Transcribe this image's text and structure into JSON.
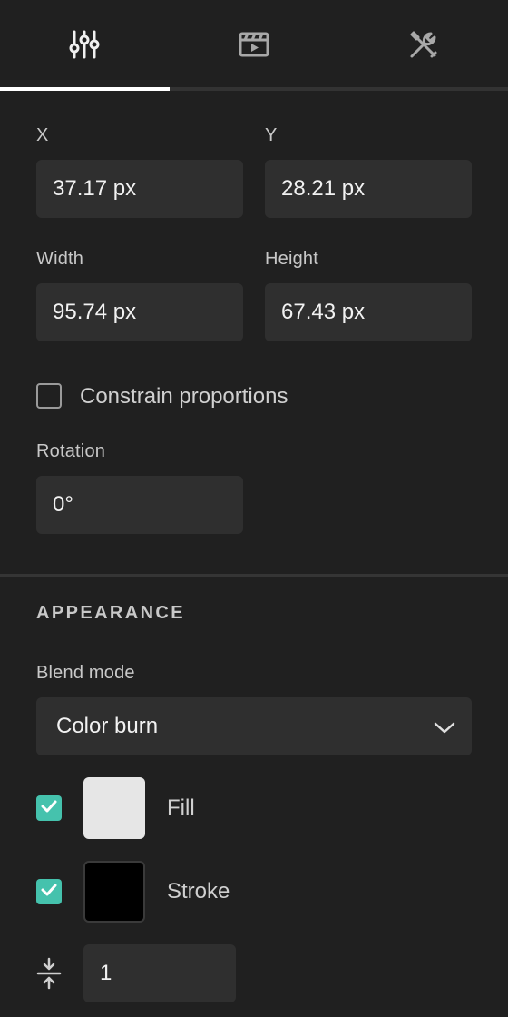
{
  "tabs": [
    {
      "icon": "sliders-icon"
    },
    {
      "icon": "video-clapperboard-icon"
    },
    {
      "icon": "tools-icon"
    }
  ],
  "transform": {
    "x_label": "X",
    "x_value": "37.17 px",
    "y_label": "Y",
    "y_value": "28.21 px",
    "width_label": "Width",
    "width_value": "95.74 px",
    "height_label": "Height",
    "height_value": "67.43 px",
    "constrain_label": "Constrain proportions",
    "constrain_checked": false,
    "rotation_label": "Rotation",
    "rotation_value": "0°"
  },
  "appearance": {
    "section_title": "APPEARANCE",
    "blend_label": "Blend mode",
    "blend_value": "Color burn",
    "fill_label": "Fill",
    "fill_checked": true,
    "fill_color": "#e6e6e6",
    "stroke_label": "Stroke",
    "stroke_checked": true,
    "stroke_color": "#000000",
    "stroke_width_value": "1"
  },
  "colors": {
    "accent": "#45c2ad",
    "background": "#202020",
    "field": "#2f2f2f"
  }
}
